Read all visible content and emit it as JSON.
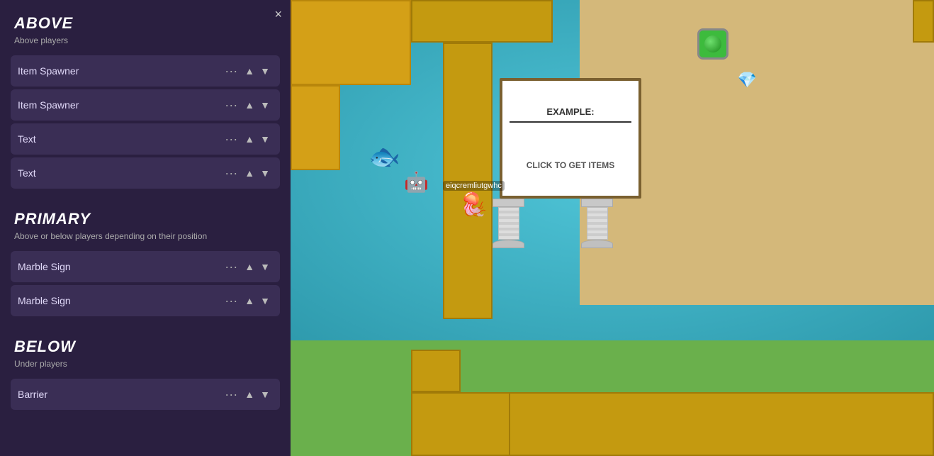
{
  "panel": {
    "close_label": "×",
    "sections": [
      {
        "id": "above",
        "title": "ABOVE",
        "subtitle": "Above players",
        "items": [
          {
            "label": "Item Spawner"
          },
          {
            "label": "Item Spawner"
          },
          {
            "label": "Text"
          },
          {
            "label": "Text"
          }
        ]
      },
      {
        "id": "primary",
        "title": "PRIMARY",
        "subtitle": "Above or below players depending on their position",
        "items": [
          {
            "label": "Marble Sign"
          },
          {
            "label": "Marble Sign"
          }
        ]
      },
      {
        "id": "below",
        "title": "BELOW",
        "subtitle": "Under players",
        "items": [
          {
            "label": "Barrier"
          }
        ]
      }
    ]
  },
  "game": {
    "player_name": "eiqcremliutgwhc",
    "sign_top": "EXAMPLE:",
    "sign_bottom": "CLICK TO GET ITEMS"
  }
}
